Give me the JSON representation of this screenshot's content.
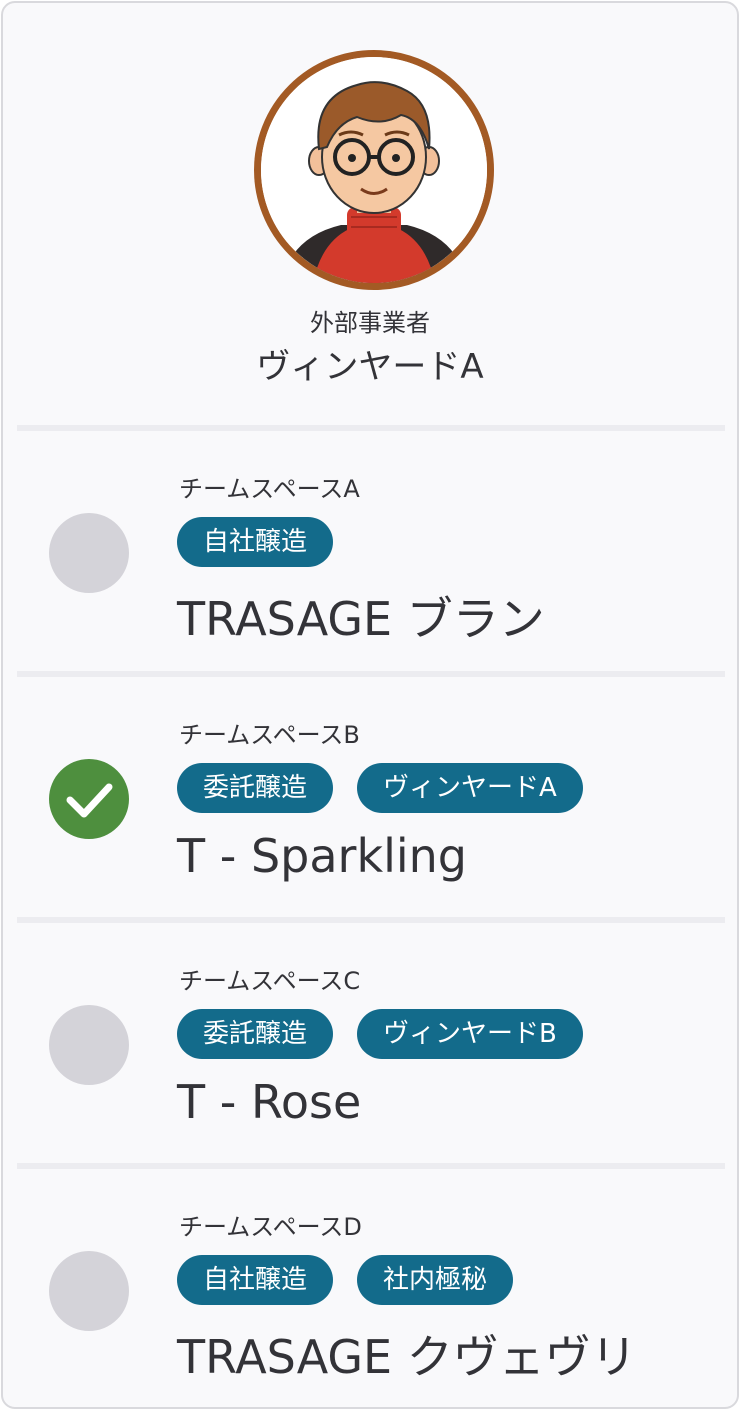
{
  "profile": {
    "role": "外部事業者",
    "name": "ヴィンヤードA",
    "avatar_icon": "person-avatar-illustration"
  },
  "colors": {
    "accent_tag": "#136b8b",
    "check_green": "#4e8f3e",
    "radio_off": "#d4d3d9",
    "avatar_ring": "#a35a24"
  },
  "items": [
    {
      "workspace": "チームスペースA",
      "tags": [
        "自社醸造"
      ],
      "product": "TRASAGE ブラン",
      "selected": false
    },
    {
      "workspace": "チームスペースB",
      "tags": [
        "委託醸造",
        "ヴィンヤードA"
      ],
      "product": "T - Sparkling",
      "selected": true
    },
    {
      "workspace": "チームスペースC",
      "tags": [
        "委託醸造",
        "ヴィンヤードB"
      ],
      "product": "T - Rose",
      "selected": false
    },
    {
      "workspace": "チームスペースD",
      "tags": [
        "自社醸造",
        "社内極秘"
      ],
      "product": "TRASAGE クヴェヴリ",
      "selected": false
    }
  ]
}
